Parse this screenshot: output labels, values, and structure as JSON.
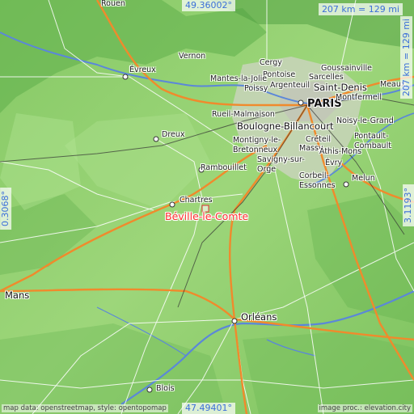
{
  "coords": {
    "top_lat": "49.36002°",
    "bottom_lat": "47.49401°",
    "left_lon": "0.3068°",
    "right_lon": "3.1193°"
  },
  "scale": {
    "horizontal": "207 km = 129 mi",
    "vertical": "207 km = 129 mi"
  },
  "credits": {
    "left": "map data: openstreetmap, style: opentopomap",
    "right": "image proc.: elevation.city"
  },
  "highlight": {
    "name": "Béville-le-Comte",
    "color": "#ff2f2f"
  },
  "places": {
    "rouen": "Rouen",
    "vernon": "Vernon",
    "evreux": "Évreux",
    "cergy": "Cergy",
    "pontoise": "Pontoise",
    "goussainville": "Goussainville",
    "mantes": "Mantes-la-Jolie",
    "sarcelles": "Sarcelles",
    "argenteuil": "Argenteuil",
    "poissy": "Poissy",
    "saint_denis": "Saint-Denis",
    "meaux": "Meaux",
    "paris": "PARIS",
    "montfermeil": "Montfermeil",
    "rueil": "Rueil-Malmaison",
    "boulogne": "Boulogne-Billancourt",
    "noisy": "Noisy-le-Grand",
    "dreux": "Dreux",
    "montigny": "Montigny-le-Bretonneux",
    "creteil": "Créteil",
    "pontault": "Pontault-Combault",
    "massy": "Massy",
    "athis": "Athis-Mons",
    "savigny": "Savigny-sur-Orge",
    "rambouillet": "Rambouillet",
    "corbeil": "Corbeil-Essonnes",
    "evry": "Évry",
    "melun": "Melun",
    "chartres": "Chartres",
    "mans": "Mans",
    "orleans": "Orléans",
    "blois": "Blois"
  },
  "colors": {
    "low": "#8fcf6e",
    "high": "#3f9a3c",
    "urban": "#cfd4c4",
    "river": "#5b87d9",
    "road_major": "#f08a2c",
    "road_minor": "#ffffff"
  }
}
